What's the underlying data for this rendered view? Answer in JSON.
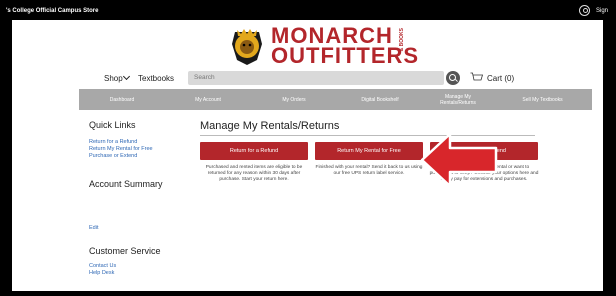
{
  "topbar": {
    "store_name": "'s College Official Campus Store",
    "sign_in": "Sign"
  },
  "logo": {
    "line1": "MONARCH",
    "line2": "OUTFITTERS",
    "books": "& BOOKS"
  },
  "nav": {
    "shop_label": "Shop",
    "textbooks_label": "Textbooks",
    "search_placeholder": "Search",
    "cart_label": "Cart (0)"
  },
  "subnav": [
    {
      "label": "Dashboard"
    },
    {
      "label": "My Account"
    },
    {
      "label": "My Orders"
    },
    {
      "label": "Digital Bookshelf"
    },
    {
      "label": "Manage My Rentals/Returns"
    },
    {
      "label": "Sell My Textbooks"
    }
  ],
  "sidebar": {
    "quick_links_title": "Quick Links",
    "quick_links": [
      "Return for a Refund",
      "Return My Rental for Free",
      "Purchase or Extend"
    ],
    "account_summary_title": "Account Summary",
    "edit_link": "Edit",
    "customer_service_title": "Customer Service",
    "service_links": [
      "Contact Us",
      "Help Desk"
    ]
  },
  "main": {
    "title": "Manage My Rentals/Returns",
    "buttons": [
      {
        "label": "Return for a Refund",
        "desc": "Purchased and rented items are eligible to be returned for any reason within 30 days after purchase. Start your return here."
      },
      {
        "label": "Return My Rental for Free",
        "desc": "Finished with your rental? Send it back to us using our free UPS return label service."
      },
      {
        "label": "tend",
        "desc": "Need more time with your rental or want to purchase it to keep? Choose your options here and easily pay for extensions and purchases."
      }
    ]
  },
  "colors": {
    "brand_red": "#b3262b",
    "subnav_gray": "#a8a8a8",
    "link_blue": "#2f68b5"
  }
}
